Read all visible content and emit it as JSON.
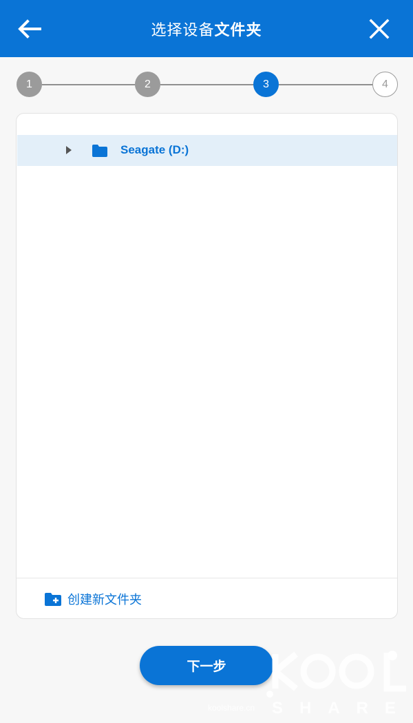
{
  "header": {
    "title_light": "选择设备",
    "title_bold": "文件夹",
    "back_icon": "arrow-left-icon",
    "close_icon": "close-icon"
  },
  "stepper": {
    "steps": [
      {
        "label": "1",
        "state": "done"
      },
      {
        "label": "2",
        "state": "done"
      },
      {
        "label": "3",
        "state": "active"
      },
      {
        "label": "4",
        "state": "todo"
      }
    ]
  },
  "tree": {
    "items": [
      {
        "label": "Seagate (D:)",
        "icon": "folder-icon",
        "expander": "caret-right-icon",
        "selected": true
      }
    ]
  },
  "footer": {
    "new_folder_label": "创建新文件夹",
    "new_folder_icon": "folder-plus-icon"
  },
  "actions": {
    "next_label": "下一步"
  },
  "watermark": {
    "logo_text": "KOOL",
    "sub_text": "SHARE",
    "site": "koolshare.cn"
  },
  "colors": {
    "accent": "#0a74d6",
    "step_done": "#9b9b9b",
    "selected_row": "#e3eff9"
  }
}
